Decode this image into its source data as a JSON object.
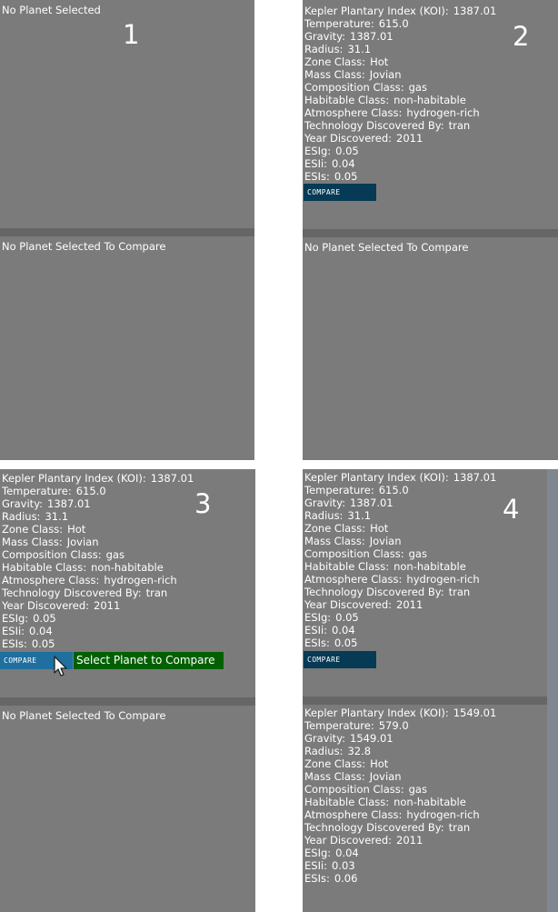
{
  "panels": [
    {
      "number": "1",
      "top_message": "No Planet Selected",
      "bottom_message": "No Planet Selected To Compare"
    },
    {
      "number": "2",
      "planet": [
        {
          "label": "Kepler Plantary Index (KOI):",
          "value": "1387.01"
        },
        {
          "label": "Temperature:",
          "value": "615.0"
        },
        {
          "label": "Gravity:",
          "value": "1387.01"
        },
        {
          "label": "Radius:",
          "value": "31.1"
        },
        {
          "label": "Zone Class:",
          "value": "Hot"
        },
        {
          "label": "Mass Class:",
          "value": "Jovian"
        },
        {
          "label": "Composition Class:",
          "value": "gas"
        },
        {
          "label": "Habitable Class:",
          "value": "non-habitable"
        },
        {
          "label": "Atmosphere Class:",
          "value": "hydrogen-rich"
        },
        {
          "label": "Technology Discovered By:",
          "value": "tran"
        },
        {
          "label": "Year Discovered:",
          "value": "2011"
        },
        {
          "label": "ESIg:",
          "value": "0.05"
        },
        {
          "label": "ESIi:",
          "value": "0.04"
        },
        {
          "label": "ESIs:",
          "value": "0.05"
        }
      ],
      "compare_label": "COMPARE",
      "bottom_message": "No Planet Selected To Compare"
    },
    {
      "number": "3",
      "planet": [
        {
          "label": "Kepler Plantary Index (KOI):",
          "value": "1387.01"
        },
        {
          "label": "Temperature:",
          "value": "615.0"
        },
        {
          "label": "Gravity:",
          "value": "1387.01"
        },
        {
          "label": "Radius:",
          "value": "31.1"
        },
        {
          "label": "Zone Class:",
          "value": "Hot"
        },
        {
          "label": "Mass Class:",
          "value": "Jovian"
        },
        {
          "label": "Composition Class:",
          "value": "gas"
        },
        {
          "label": "Habitable Class:",
          "value": "non-habitable"
        },
        {
          "label": "Atmosphere Class:",
          "value": "hydrogen-rich"
        },
        {
          "label": "Technology Discovered By:",
          "value": "tran"
        },
        {
          "label": "Year Discovered:",
          "value": "2011"
        },
        {
          "label": "ESIg:",
          "value": "0.05"
        },
        {
          "label": "ESIi:",
          "value": "0.04"
        },
        {
          "label": "ESIs:",
          "value": "0.05"
        }
      ],
      "compare_label": "COMPARE",
      "tooltip": "Select Planet to Compare",
      "bottom_message": "No Planet Selected To Compare"
    },
    {
      "number": "4",
      "planet": [
        {
          "label": "Kepler Plantary Index (KOI):",
          "value": "1387.01"
        },
        {
          "label": "Temperature:",
          "value": "615.0"
        },
        {
          "label": "Gravity:",
          "value": "1387.01"
        },
        {
          "label": "Radius:",
          "value": "31.1"
        },
        {
          "label": "Zone Class:",
          "value": "Hot"
        },
        {
          "label": "Mass Class:",
          "value": "Jovian"
        },
        {
          "label": "Composition Class:",
          "value": "gas"
        },
        {
          "label": "Habitable Class:",
          "value": "non-habitable"
        },
        {
          "label": "Atmosphere Class:",
          "value": "hydrogen-rich"
        },
        {
          "label": "Technology Discovered By:",
          "value": "tran"
        },
        {
          "label": "Year Discovered:",
          "value": "2011"
        },
        {
          "label": "ESIg:",
          "value": "0.05"
        },
        {
          "label": "ESIi:",
          "value": "0.04"
        },
        {
          "label": "ESIs:",
          "value": "0.05"
        }
      ],
      "compare_label": "COMPARE",
      "compare_planet": [
        {
          "label": "Kepler Plantary Index (KOI):",
          "value": "1549.01"
        },
        {
          "label": "Temperature:",
          "value": "579.0"
        },
        {
          "label": "Gravity:",
          "value": "1549.01"
        },
        {
          "label": "Radius:",
          "value": "32.8"
        },
        {
          "label": "Zone Class:",
          "value": "Hot"
        },
        {
          "label": "Mass Class:",
          "value": "Jovian"
        },
        {
          "label": "Composition Class:",
          "value": "gas"
        },
        {
          "label": "Habitable Class:",
          "value": "non-habitable"
        },
        {
          "label": "Atmosphere Class:",
          "value": "hydrogen-rich"
        },
        {
          "label": "Technology Discovered By:",
          "value": "tran"
        },
        {
          "label": "Year Discovered:",
          "value": "2011"
        },
        {
          "label": "ESIg:",
          "value": "0.04"
        },
        {
          "label": "ESIi:",
          "value": "0.03"
        },
        {
          "label": "ESIs:",
          "value": "0.06"
        }
      ]
    }
  ],
  "icons": {
    "cursor": "mouse-pointer-icon"
  },
  "colors": {
    "panel_bg": "#7b7b7b",
    "divider": "#666666",
    "compare_button": "#073a55",
    "compare_button_hover": "#1f6f9f",
    "tooltip": "#026002"
  }
}
